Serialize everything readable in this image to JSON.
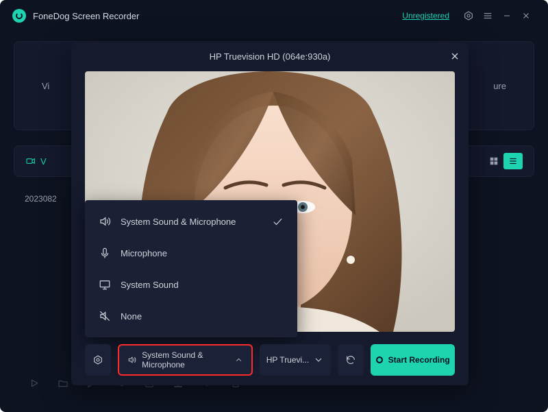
{
  "titlebar": {
    "app_name": "FoneDog Screen Recorder",
    "status_link": "Unregistered"
  },
  "background": {
    "left_label": "Vi",
    "right_label": "ure",
    "tab_label": "V",
    "list_entry": "2023082"
  },
  "modal": {
    "camera_title": "HP Truevision HD (064e:930a)",
    "audio_button_label": "System Sound & Microphone",
    "camera_button_label": "HP Truevi...",
    "start_button_label": "Start Recording"
  },
  "audio_menu": {
    "items": [
      {
        "label": "System Sound & Microphone",
        "icon": "volume",
        "selected": true
      },
      {
        "label": "Microphone",
        "icon": "mic",
        "selected": false
      },
      {
        "label": "System Sound",
        "icon": "monitor",
        "selected": false
      },
      {
        "label": "None",
        "icon": "mute",
        "selected": false
      }
    ]
  }
}
